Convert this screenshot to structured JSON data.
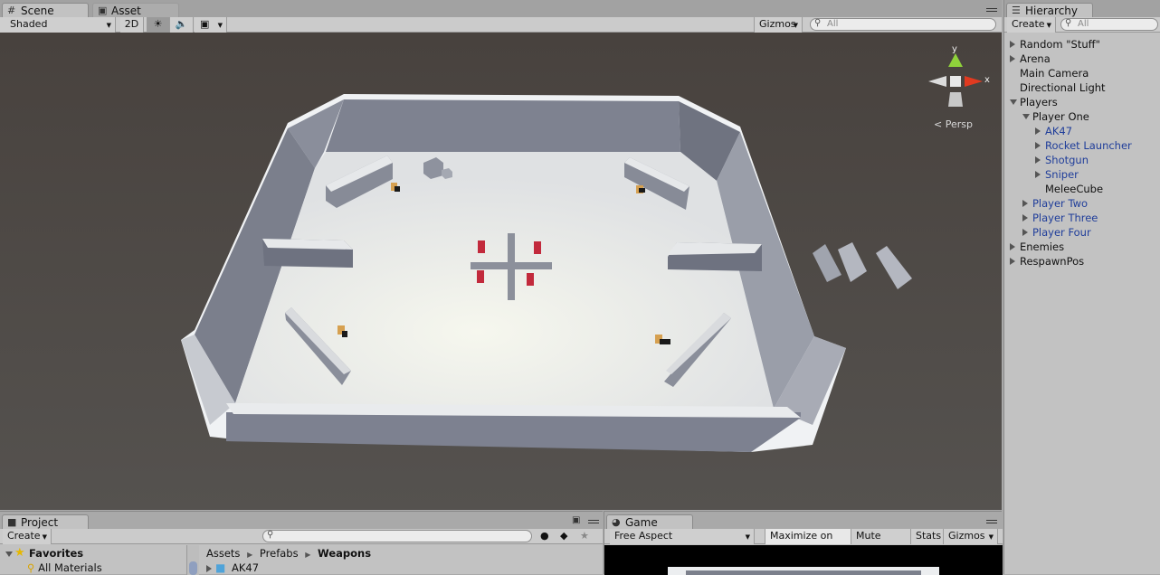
{
  "scene": {
    "tabs": [
      {
        "label": "Scene",
        "active": true
      },
      {
        "label": "Asset Store",
        "active": false
      }
    ],
    "toolbar": {
      "render_mode": "Shaded",
      "mode_2d": "2D",
      "gizmos": "Gizmos",
      "search_placeholder": "All"
    },
    "view": {
      "projection_label": "Persp",
      "axis_x": "x",
      "axis_y": "y",
      "colors": {
        "background": "#4a4744",
        "floor": "#e4e6e4",
        "wall_inner": "#7c808c",
        "wall_top": "#eef0f2",
        "cube": "#bf2a3a",
        "crate": "#d8a254",
        "axis_x": "#e03a20",
        "axis_y": "#8fd13b"
      }
    }
  },
  "hierarchy": {
    "tab_label": "Hierarchy",
    "create_label": "Create",
    "search_placeholder": "All",
    "items": [
      {
        "label": "Random \"Stuff\"",
        "indent": 0,
        "arrow": "right",
        "prefab": false
      },
      {
        "label": "Arena",
        "indent": 0,
        "arrow": "right",
        "prefab": false
      },
      {
        "label": "Main Camera",
        "indent": 0,
        "arrow": "none",
        "prefab": false
      },
      {
        "label": "Directional Light",
        "indent": 0,
        "arrow": "none",
        "prefab": false
      },
      {
        "label": "Players",
        "indent": 0,
        "arrow": "down",
        "prefab": false
      },
      {
        "label": "Player One",
        "indent": 1,
        "arrow": "down",
        "prefab": false
      },
      {
        "label": "AK47",
        "indent": 2,
        "arrow": "right",
        "prefab": true
      },
      {
        "label": "Rocket Launcher",
        "indent": 2,
        "arrow": "right",
        "prefab": true
      },
      {
        "label": "Shotgun",
        "indent": 2,
        "arrow": "right",
        "prefab": true
      },
      {
        "label": "Sniper",
        "indent": 2,
        "arrow": "right",
        "prefab": true
      },
      {
        "label": "MeleeCube",
        "indent": 2,
        "arrow": "none",
        "prefab": false
      },
      {
        "label": "Player Two",
        "indent": 1,
        "arrow": "right",
        "prefab": true
      },
      {
        "label": "Player Three",
        "indent": 1,
        "arrow": "right",
        "prefab": true
      },
      {
        "label": "Player Four",
        "indent": 1,
        "arrow": "right",
        "prefab": true
      },
      {
        "label": "Enemies",
        "indent": 0,
        "arrow": "right",
        "prefab": false
      },
      {
        "label": "RespawnPos",
        "indent": 0,
        "arrow": "right",
        "prefab": false
      }
    ]
  },
  "project": {
    "tab_label": "Project",
    "create_label": "Create",
    "favorites_label": "Favorites",
    "favorites_items": [
      "All Materials"
    ],
    "breadcrumb": [
      "Assets",
      "Prefabs",
      "Weapons"
    ],
    "assets": [
      "AK47"
    ]
  },
  "game": {
    "tab_label": "Game",
    "aspect": "Free Aspect",
    "maximize_on_play": "Maximize on Play",
    "mute_audio": "Mute audio",
    "stats": "Stats",
    "gizmos": "Gizmos"
  }
}
